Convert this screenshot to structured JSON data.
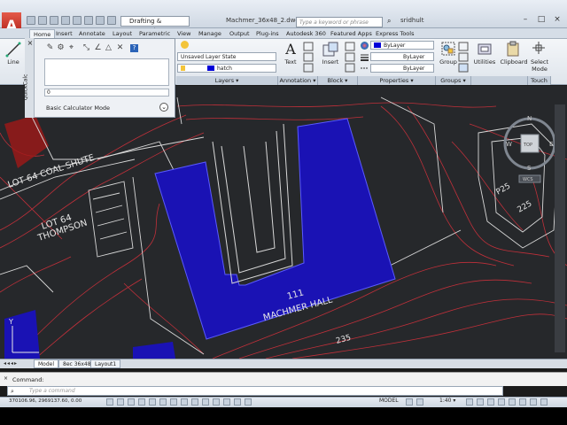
{
  "titlebar": {
    "logo": "A",
    "workspace": "Drafting & Annotation",
    "document": "Machmer_36x48_2.dwg",
    "search_placeholder": "Type a keyword or phrase",
    "user": "sridhult",
    "help": "?",
    "minimize": "–",
    "maximize": "□",
    "close": "×"
  },
  "tabs": [
    "Home",
    "Insert",
    "Annotate",
    "Layout",
    "Parametric",
    "View",
    "Manage",
    "Output",
    "Plug-ins",
    "Autodesk 360",
    "Featured Apps",
    "Express Tools"
  ],
  "ribbon": {
    "line": "Line",
    "layer_state": "Unsaved Layer State",
    "layer_name": "hatch",
    "text": "Text",
    "insert": "Insert",
    "bylayer": "ByLayer",
    "group": "Group",
    "utilities": "Utilities",
    "clipboard": "Clipboard",
    "select_mode": "Select Mode",
    "panels": {
      "layers": "Layers ▾",
      "annotation": "Annotation ▾",
      "block": "Block ▾",
      "properties": "Properties ▾",
      "groups": "Groups ▾",
      "touch": "Touch"
    }
  },
  "quickcalc": {
    "side_label": "QuickCalc",
    "input_value": "0",
    "mode_label": "Basic Calculator Mode"
  },
  "drawing": {
    "label_lot64_coal": "LOT 64 COAL SHUTE",
    "label_lot64_thompson_1": "LOT 64",
    "label_lot64_thompson_2": "THOMPSON",
    "label_number": "111",
    "label_hall": "MACHMER HALL",
    "label_235": "235",
    "label_p25": "P25",
    "label_225": "225",
    "viewcube": {
      "n": "N",
      "w": "W",
      "e": "E",
      "s": "S",
      "top": "TOP",
      "wcs": "WCS"
    },
    "ucs_y": "Y",
    "colors": {
      "building": "#1a12b4",
      "contour": "#c0303a",
      "linework": "#d8d8d8",
      "background": "#26282b"
    }
  },
  "layout_tabs": [
    "Model",
    "8ec 36x48",
    "Layout1"
  ],
  "command": {
    "history": "Command:",
    "placeholder": "Type a command"
  },
  "status": {
    "coords": "370106.96, 2969137.60, 0.00",
    "model": "MODEL",
    "scale": "1:40 ▾"
  }
}
